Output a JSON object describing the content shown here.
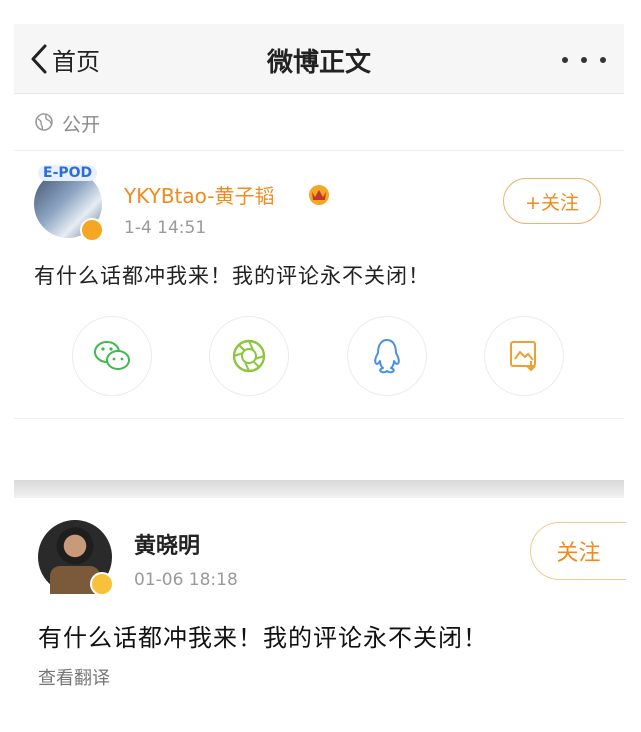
{
  "nav": {
    "back_label": "首页",
    "title": "微博正文",
    "more_icon": "more-horizontal-icon"
  },
  "visibility": {
    "icon": "globe-icon",
    "label": "公开"
  },
  "post1": {
    "avatar_tag": "E-POD",
    "username": "YKYBtao-黄子韬",
    "time": "1-4 14:51",
    "follow_label": "+关注",
    "content": "有什么话都冲我来！我的评论永不关闭！",
    "share_icons": [
      "wechat-icon",
      "moments-icon",
      "qq-icon",
      "save-image-icon"
    ],
    "colors": {
      "username": "#f08a1c",
      "wechat": "#3fba4f",
      "moments": "#8cc63e",
      "qq": "#4a90e2",
      "save": "#f0a030"
    }
  },
  "post2": {
    "username": "黄晓明",
    "time": "01-06 18:18",
    "follow_label": "关注",
    "content": "有什么话都冲我来！我的评论永不关闭！",
    "translate_label": "查看翻译"
  }
}
